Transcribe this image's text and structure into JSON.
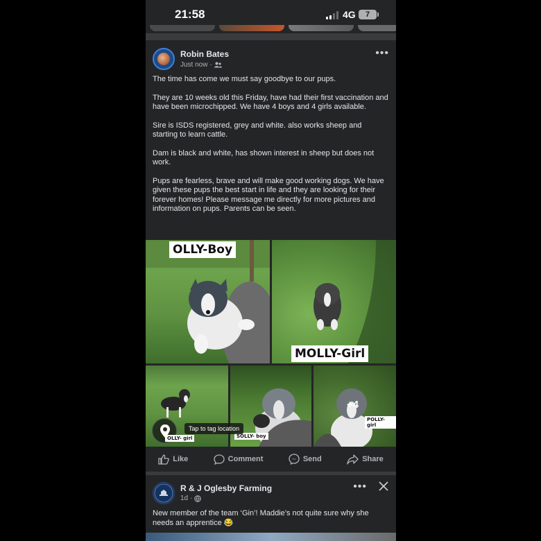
{
  "status_bar": {
    "time": "21:58",
    "network": "4G",
    "battery": "7"
  },
  "post": {
    "author": "Robin Bates",
    "timestamp": "Just now",
    "audience_icon": "friends-icon",
    "paragraphs": [
      "The time has come we must say goodbye to our pups.",
      "They are 10 weeks old this Friday, have had their first vaccination and have been microchipped. We have 4 boys and 4 girls available.",
      "Sire is ISDS registered, grey and white. also works sheep and starting to learn cattle.",
      "Dam is black and white, has shown interest in sheep but does not work.",
      "Pups are fearless, brave and will make good working dogs. We have given these pups the best start in life and they are looking for their forever homes! Please message me directly for more pictures and information on pups. Parents can be seen."
    ],
    "photos": {
      "label_1": "OLLY-Boy",
      "label_2": "MOLLY-Girl",
      "label_3": "OLLY- girl",
      "label_4": "SOLLY- boy",
      "label_5": "POLLY-girl",
      "more_count": "+4",
      "tag_tooltip": "Tap to tag location"
    },
    "actions": {
      "like": "Like",
      "comment": "Comment",
      "send": "Send",
      "share": "Share"
    }
  },
  "post2": {
    "author": "R & J Oglesby Farming",
    "timestamp": "1d",
    "text": "New member of the team ‘Gin’! Maddie’s not quite sure why she needs an apprentice 😂"
  },
  "colors": {
    "background": "#242526",
    "separator": "#3a3b3c",
    "text": "#e4e6eb",
    "secondary_text": "#b0b3b8",
    "accent": "#3f7fd6"
  }
}
